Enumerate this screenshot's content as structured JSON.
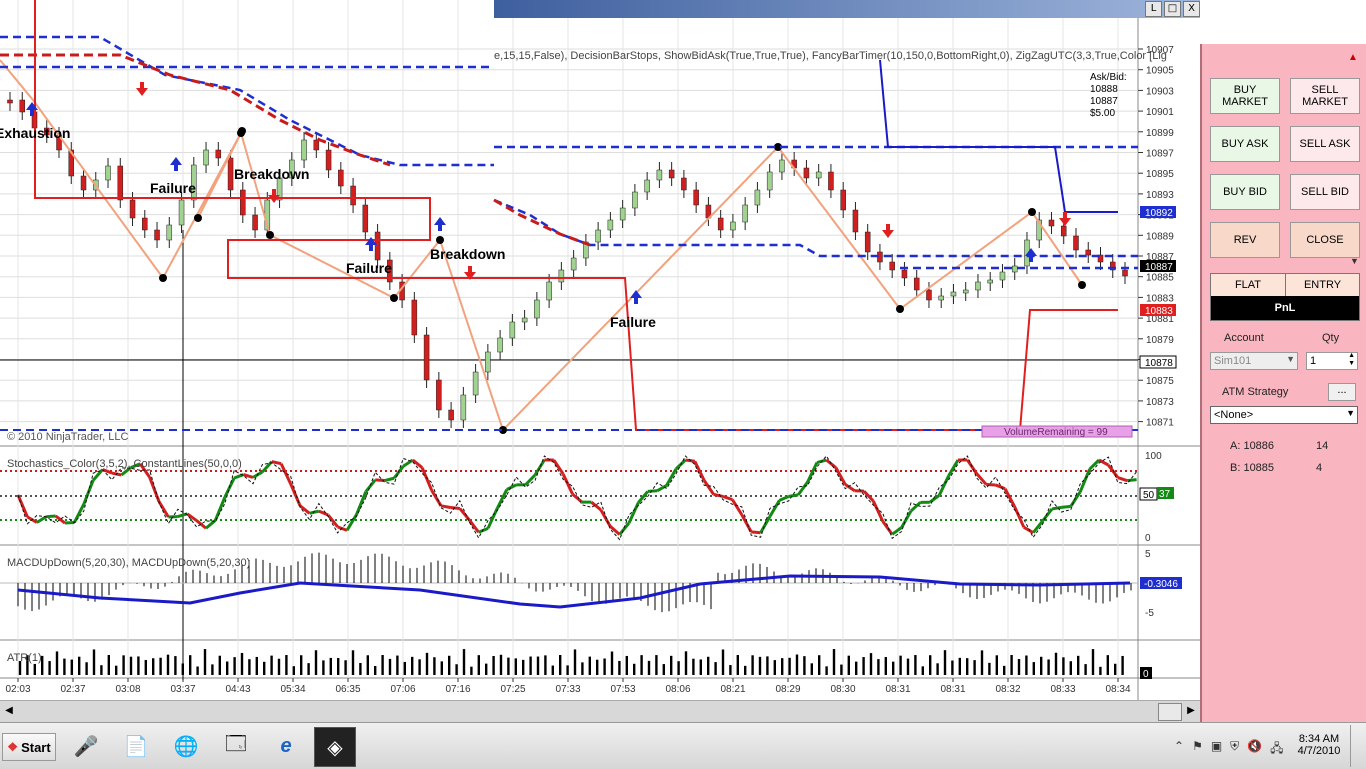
{
  "window": {
    "btn_min": "L",
    "btn_restore": "□",
    "btn_close": "X",
    "scroll_left": "◀",
    "scroll_right": "▶"
  },
  "chart": {
    "indicator_string": "e,15,15,False), DecisionBarStops, ShowBidAsk(True,True,True), FancyBarTimer(10,150,0,BottomRight,0), ZigZagUTC(3,3,True,Color [Lig",
    "copyright": "© 2010 NinjaTrader, LLC",
    "askbid": [
      "Ask/Bid:",
      "10888",
      "10887",
      "$5.00"
    ],
    "price_labels": [
      "10907",
      "10905",
      "10903",
      "10901",
      "10899",
      "10897",
      "10895",
      "10893",
      "10891",
      "10889",
      "10887",
      "10885",
      "10883",
      "10881",
      "10879",
      "10877",
      "10875",
      "10873",
      "10871"
    ],
    "price_flags": {
      "blue": "10892",
      "black": "10887",
      "red": "10883",
      "line": "10878"
    },
    "annotations": [
      "Exhaustion",
      "Failure",
      "Breakdown",
      "Failure",
      "Breakdown",
      "Failure"
    ],
    "volume_text": "VolumeRemaining = 99",
    "stoch_label": "Stochastics_Color(3,5,2), ConstantLines(50,0,0)",
    "stoch_scale": [
      "100",
      "50",
      "0"
    ],
    "stoch_flags": [
      "50",
      "37"
    ],
    "macd_label": "MACDUpDown(5,20,30), MACDUpDown(5,20,30)",
    "macd_scale": [
      "5",
      "-5"
    ],
    "macd_flag": "-0.3046",
    "atr_label": "ATR(1)",
    "atr_flag": "0",
    "time_labels": [
      "02:03",
      "02:37",
      "03:08",
      "03:37",
      "04:43",
      "05:34",
      "06:35",
      "07:06",
      "07:16",
      "07:25",
      "07:33",
      "07:53",
      "08:06",
      "08:21",
      "08:29",
      "08:30",
      "08:31",
      "08:31",
      "08:32",
      "08:33",
      "08:34"
    ],
    "colors": {
      "up": "#9fd38f",
      "down": "#d01f1f",
      "zig": "#f2a27c",
      "stopline": "#e02020",
      "bluedash": "#1f2fcf",
      "green": "#138a13"
    }
  },
  "panel": {
    "buy_market": "BUY MARKET",
    "sell_market": "SELL MARKET",
    "buy_ask": "BUY ASK",
    "sell_ask": "SELL ASK",
    "buy_bid": "BUY BID",
    "sell_bid": "SELL BID",
    "rev": "REV",
    "close": "CLOSE",
    "flat": "FLAT",
    "entry": "ENTRY",
    "pnl": "PnL",
    "account_label": "Account",
    "qty_label": "Qty",
    "account_value": "Sim101",
    "qty_value": "1",
    "atm_label": "ATM Strategy",
    "atm_btn": "...",
    "atm_value": "<None>",
    "a_label": "A: 10886",
    "a_size": "14",
    "b_label": "B: 10885",
    "b_size": "4"
  },
  "taskbar": {
    "start": "Start",
    "time": "8:34 AM",
    "date": "4/7/2010"
  }
}
